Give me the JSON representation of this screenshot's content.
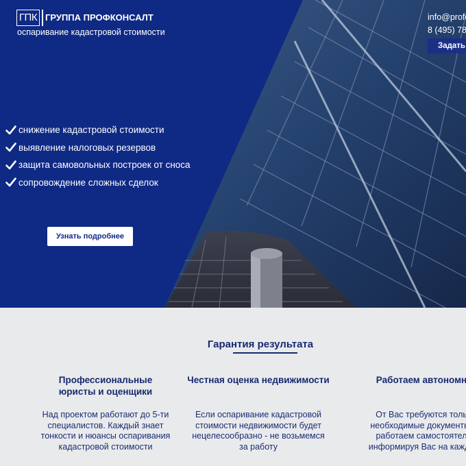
{
  "header": {
    "logo_text": "ГПК",
    "brand_name": "ГРУППА ПРОФКОНСАЛТ",
    "tagline": "оспаривание кадастровой стоимости",
    "email": "info@profc",
    "phone": "8 (495) 78",
    "ask_button_label": "Задать"
  },
  "hero": {
    "features": [
      "снижение кадастровой стоимости",
      "выявление налоговых резервов",
      "защита самовольных построек от сноса",
      "сопровождение сложных сделок"
    ],
    "more_button_label": "Узнать подробнее"
  },
  "guarantee": {
    "title": "Гарантия результата",
    "columns": [
      {
        "title": "Профессиональные\nюристы и оценщики",
        "text": "Над проектом работают до 5-ти\nспециалистов. Каждый знает\nтонкости и нюансы оспаривания\nкадастровой стоимости"
      },
      {
        "title": "Честная оценка недвижимости",
        "text": "Если оспаривание кадастровой\nстоимости недвижимости будет\nнецелесообразно - не возьмемся\nза работу"
      },
      {
        "title": "Работаем автономн",
        "text": "От Вас требуются толь\nнеобходимые документы. \nработаем самостоятел\nинформируя Вас на каждо"
      }
    ]
  },
  "colors": {
    "hero_blue": "#0f2a85",
    "heading_navy": "#16296f",
    "section_bg": "#e9eaec"
  }
}
